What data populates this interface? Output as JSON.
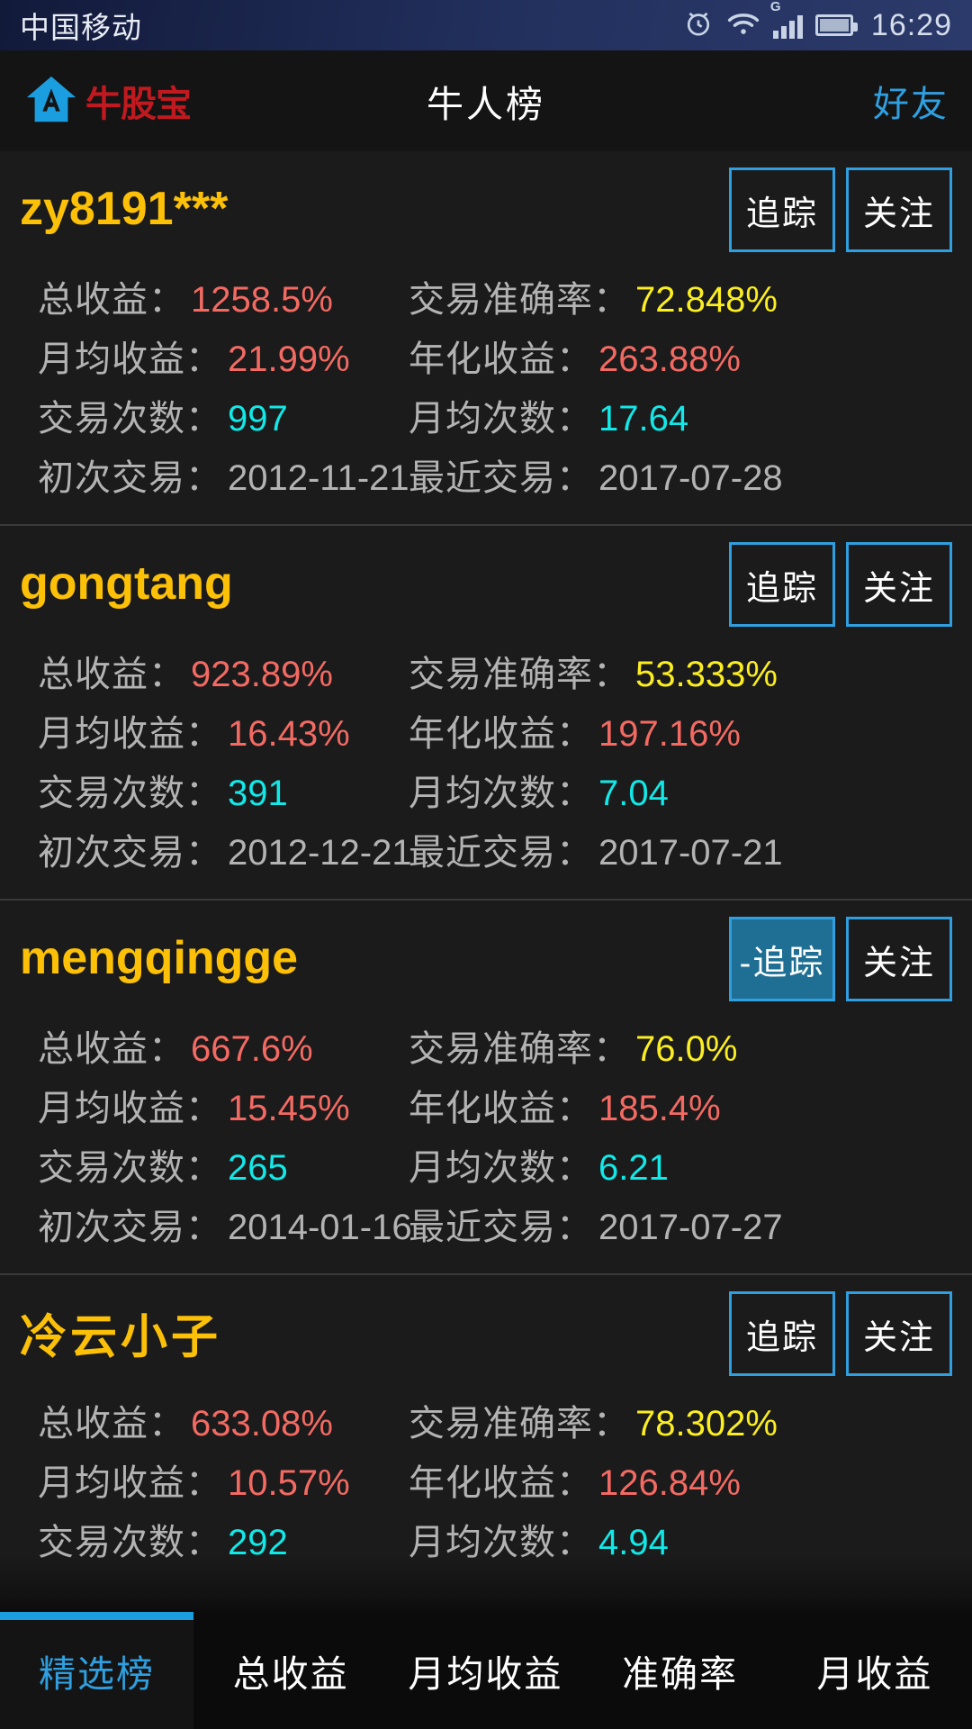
{
  "status_bar": {
    "carrier": "中国移动",
    "time": "16:29",
    "network_label": "G",
    "icons": [
      "alarm-icon",
      "wifi-icon",
      "signal-icon",
      "battery-icon"
    ]
  },
  "app_bar": {
    "logo_icon": "house-icon",
    "brand": "牛股宝",
    "title": "牛人榜",
    "action": "好友"
  },
  "labels": {
    "total_return": "总收益：",
    "accuracy": "交易准确率：",
    "monthly_return": "月均收益：",
    "annualized": "年化收益：",
    "trade_count": "交易次数：",
    "monthly_count": "月均次数：",
    "first_trade": "初次交易：",
    "last_trade": "最近交易："
  },
  "buttons": {
    "track": "追踪",
    "track_active": "-追踪",
    "follow": "关注"
  },
  "colors": {
    "accent_blue": "#2f9fe0",
    "name_yellow": "#fcc007",
    "brand_red": "#c0191f",
    "value_red": "#f46a63",
    "value_yellow": "#fbee21",
    "value_cyan": "#12e8e8",
    "label_gray": "#b3b3b3",
    "track_filled_bg": "#1f6f94"
  },
  "cards": [
    {
      "name": "zy8191***",
      "name_is_cjk": false,
      "track_label": "追踪",
      "track_active": false,
      "follow_label": "关注",
      "total_return": "1258.5%",
      "accuracy": "72.848%",
      "monthly_return": "21.99%",
      "annualized": "263.88%",
      "trade_count": "997",
      "monthly_count": "17.64",
      "first_trade": "2012-11-21",
      "last_trade": "2017-07-28"
    },
    {
      "name": "gongtang",
      "name_is_cjk": false,
      "track_label": "追踪",
      "track_active": false,
      "follow_label": "关注",
      "total_return": "923.89%",
      "accuracy": "53.333%",
      "monthly_return": "16.43%",
      "annualized": "197.16%",
      "trade_count": "391",
      "monthly_count": "7.04",
      "first_trade": "2012-12-21",
      "last_trade": "2017-07-21"
    },
    {
      "name": "mengqingge",
      "name_is_cjk": false,
      "track_label": "-追踪",
      "track_active": true,
      "follow_label": "关注",
      "total_return": "667.6%",
      "accuracy": "76.0%",
      "monthly_return": "15.45%",
      "annualized": "185.4%",
      "trade_count": "265",
      "monthly_count": "6.21",
      "first_trade": "2014-01-16",
      "last_trade": "2017-07-27"
    },
    {
      "name": "冷云小子",
      "name_is_cjk": true,
      "track_label": "追踪",
      "track_active": false,
      "follow_label": "关注",
      "total_return": "633.08%",
      "accuracy": "78.302%",
      "monthly_return": "10.57%",
      "annualized": "126.84%",
      "trade_count": "292",
      "monthly_count": "4.94",
      "first_trade": "",
      "last_trade": ""
    }
  ],
  "tabs": [
    {
      "label": "精选榜",
      "active": true
    },
    {
      "label": "总收益",
      "active": false
    },
    {
      "label": "月均收益",
      "active": false
    },
    {
      "label": "准确率",
      "active": false
    },
    {
      "label": "月收益",
      "active": false
    }
  ]
}
